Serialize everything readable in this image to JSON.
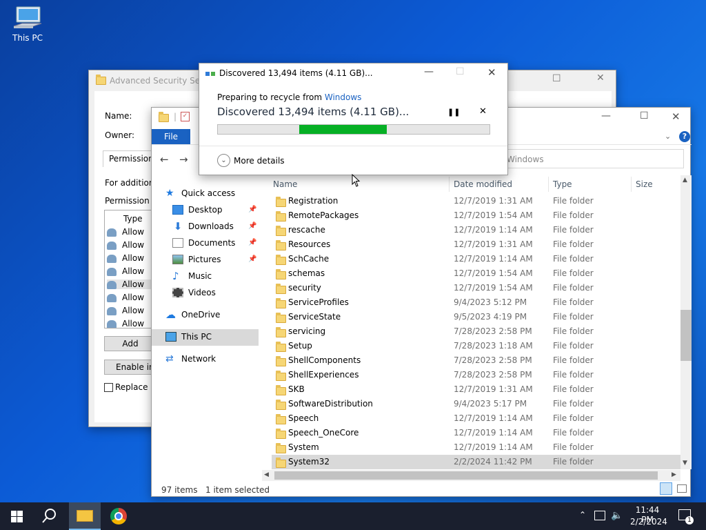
{
  "desktop": {
    "icon_label": "This PC"
  },
  "adv_window": {
    "title": "Advanced Security Settings for Windows",
    "name_label": "Name:",
    "owner_label": "Owner:",
    "tab": "Permissions",
    "for_additional": "For additional information, double-click a permission entry.",
    "perm_entries": "Permission entries:",
    "type_header": "Type",
    "rows": [
      "Allow",
      "Allow",
      "Allow",
      "Allow",
      "Allow",
      "Allow",
      "Allow",
      "Allow"
    ],
    "add_btn": "Add",
    "enable_btn": "Enable inheritance",
    "replace_label": "Replace all child object permission entries"
  },
  "explorer": {
    "file_tab": "File",
    "search_placeholder": "Windows",
    "nav": {
      "quick_access": "Quick access",
      "desktop": "Desktop",
      "downloads": "Downloads",
      "documents": "Documents",
      "pictures": "Pictures",
      "music": "Music",
      "videos": "Videos",
      "onedrive": "OneDrive",
      "thispc": "This PC",
      "network": "Network"
    },
    "columns": {
      "name": "Name",
      "date": "Date modified",
      "type": "Type",
      "size": "Size"
    },
    "files": [
      {
        "name": "Registration",
        "date": "12/7/2019 1:31 AM",
        "type": "File folder"
      },
      {
        "name": "RemotePackages",
        "date": "12/7/2019 1:54 AM",
        "type": "File folder"
      },
      {
        "name": "rescache",
        "date": "12/7/2019 1:14 AM",
        "type": "File folder"
      },
      {
        "name": "Resources",
        "date": "12/7/2019 1:31 AM",
        "type": "File folder"
      },
      {
        "name": "SchCache",
        "date": "12/7/2019 1:14 AM",
        "type": "File folder"
      },
      {
        "name": "schemas",
        "date": "12/7/2019 1:54 AM",
        "type": "File folder"
      },
      {
        "name": "security",
        "date": "12/7/2019 1:54 AM",
        "type": "File folder"
      },
      {
        "name": "ServiceProfiles",
        "date": "9/4/2023 5:12 PM",
        "type": "File folder"
      },
      {
        "name": "ServiceState",
        "date": "9/5/2023 4:19 PM",
        "type": "File folder"
      },
      {
        "name": "servicing",
        "date": "7/28/2023 2:58 PM",
        "type": "File folder"
      },
      {
        "name": "Setup",
        "date": "7/28/2023 1:18 AM",
        "type": "File folder"
      },
      {
        "name": "ShellComponents",
        "date": "7/28/2023 2:58 PM",
        "type": "File folder"
      },
      {
        "name": "ShellExperiences",
        "date": "7/28/2023 2:58 PM",
        "type": "File folder"
      },
      {
        "name": "SKB",
        "date": "12/7/2019 1:31 AM",
        "type": "File folder"
      },
      {
        "name": "SoftwareDistribution",
        "date": "9/4/2023 5:17 PM",
        "type": "File folder"
      },
      {
        "name": "Speech",
        "date": "12/7/2019 1:14 AM",
        "type": "File folder"
      },
      {
        "name": "Speech_OneCore",
        "date": "12/7/2019 1:14 AM",
        "type": "File folder"
      },
      {
        "name": "System",
        "date": "12/7/2019 1:14 AM",
        "type": "File folder"
      },
      {
        "name": "System32",
        "date": "2/2/2024 11:42 PM",
        "type": "File folder"
      }
    ],
    "status_count": "97 items",
    "status_selected": "1 item selected"
  },
  "progress": {
    "title": "Discovered 13,494 items (4.11 GB)...",
    "preparing": "Preparing to recycle from ",
    "source": "Windows",
    "heading": "Discovered 13,494 items (4.11 GB)...",
    "more": "More details",
    "accent": "#06b025"
  },
  "taskbar": {
    "time": "11:44 PM",
    "date": "2/2/2024",
    "notif_count": "1"
  }
}
